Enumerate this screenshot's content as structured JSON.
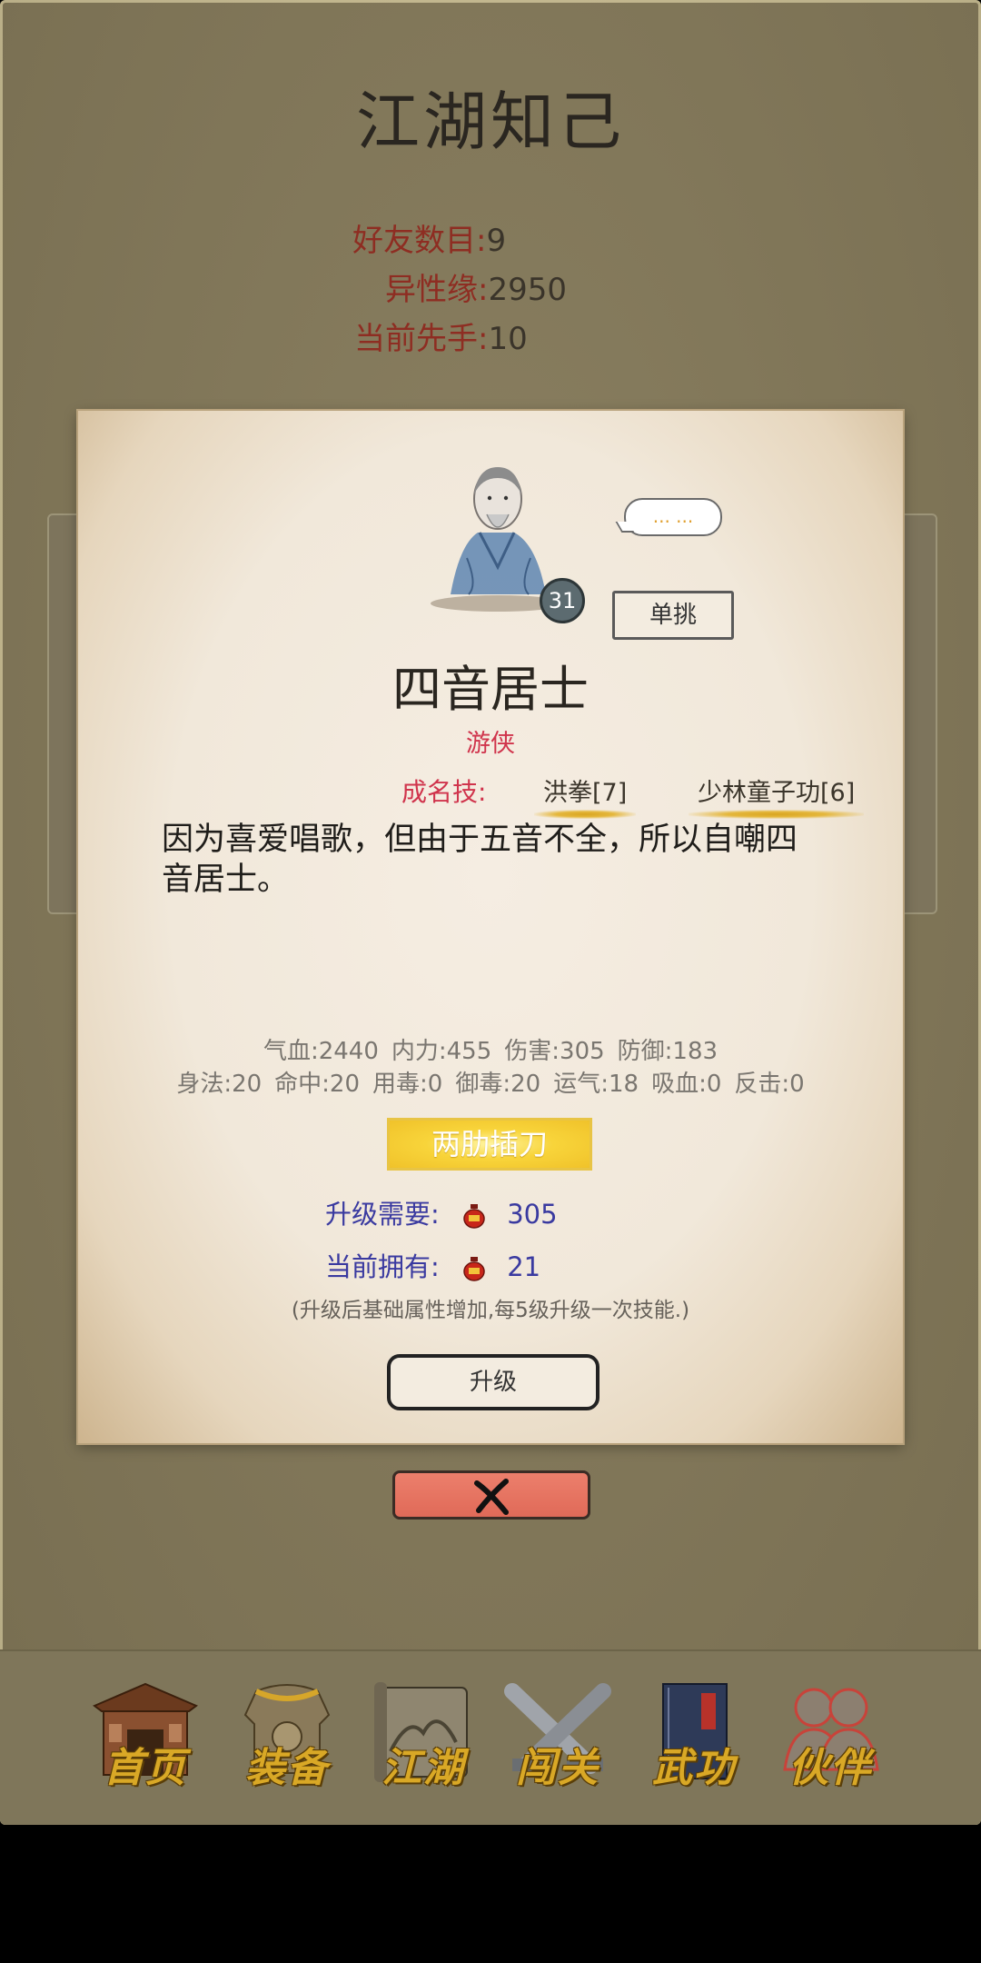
{
  "page_title": "江湖知己",
  "stats": [
    {
      "label": "好友数目:",
      "value": "9"
    },
    {
      "label": "异性缘:",
      "value": "2950"
    },
    {
      "label": "当前先手:",
      "value": "10"
    }
  ],
  "npc": {
    "level": "31",
    "speech": "... ...",
    "duel_label": "单挑",
    "name": "四音居士",
    "class": "游侠",
    "skills_label": "成名技:",
    "skills": [
      "洪拳[7]",
      "少林童子功[6]"
    ],
    "description": "因为喜爱唱歌，但由于五音不全，所以自嘲四音居士。",
    "attrs_line1": [
      "气血:2440",
      "内力:455",
      "伤害:305",
      "防御:183"
    ],
    "attrs_line2": [
      "身法:20",
      "命中:20",
      "用毒:0",
      "御毒:20",
      "运气:18",
      "吸血:0",
      "反击:0"
    ],
    "special_skill": "两肋插刀",
    "upgrade_need_label": "升级需要:",
    "upgrade_need_value": "305",
    "owned_label": "当前拥有:",
    "owned_value": "21",
    "note": "(升级后基础属性增加,每5级升级一次技能.)",
    "upgrade_label": "升级"
  },
  "nav": [
    {
      "label": "首页",
      "icon": "house-icon"
    },
    {
      "label": "装备",
      "icon": "armor-icon"
    },
    {
      "label": "江湖",
      "icon": "scroll-map-icon"
    },
    {
      "label": "闯关",
      "icon": "crossed-swords-icon"
    },
    {
      "label": "武功",
      "icon": "book-icon"
    },
    {
      "label": "伙伴",
      "icon": "companions-icon"
    }
  ],
  "colors": {
    "background": "#857a5a",
    "paper": "#f1e8da",
    "accent_red": "#d0344c",
    "stat_label": "#8e2d22",
    "cost_text": "#3a3aa0",
    "gold": "#d9a826",
    "close_button": "#e06a58"
  }
}
